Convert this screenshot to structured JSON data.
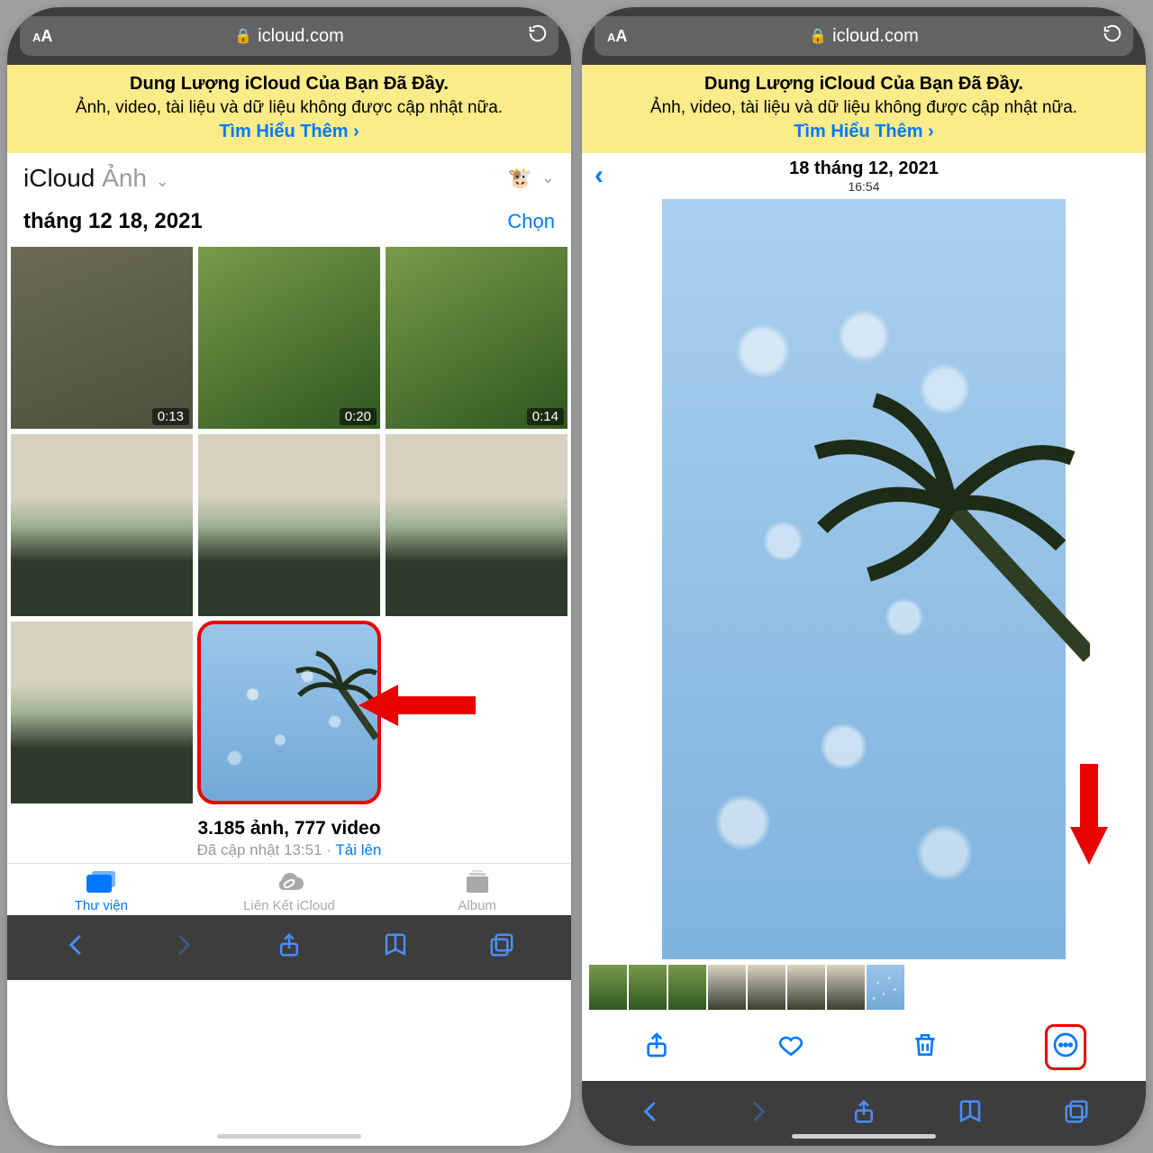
{
  "safari": {
    "domain": "icloud.com"
  },
  "banner": {
    "title": "Dung Lượng iCloud Của Bạn Đã Đầy.",
    "body": "Ảnh, video, tài liệu và dữ liệu không được cập nhật nữa.",
    "link": "Tìm Hiểu Thêm"
  },
  "left": {
    "header": {
      "app": "iCloud",
      "section": "Ảnh",
      "avatar": "🐮"
    },
    "date": "tháng 12 18, 2021",
    "select_label": "Chọn",
    "video_durations": [
      "0:13",
      "0:20",
      "0:14"
    ],
    "counts": {
      "main": "3.185 ảnh, 777 video",
      "sub_a": "Đã cập nhật 13:51",
      "sub_b": "Tải lên"
    },
    "tabs": [
      "Thư viện",
      "Liên Kết iCloud",
      "Album"
    ]
  },
  "right": {
    "date": "18 tháng 12, 2021",
    "time": "16:54"
  },
  "colors": {
    "accent": "#0079ff",
    "annotation": "#e90000",
    "banner": "#fbeb89"
  }
}
